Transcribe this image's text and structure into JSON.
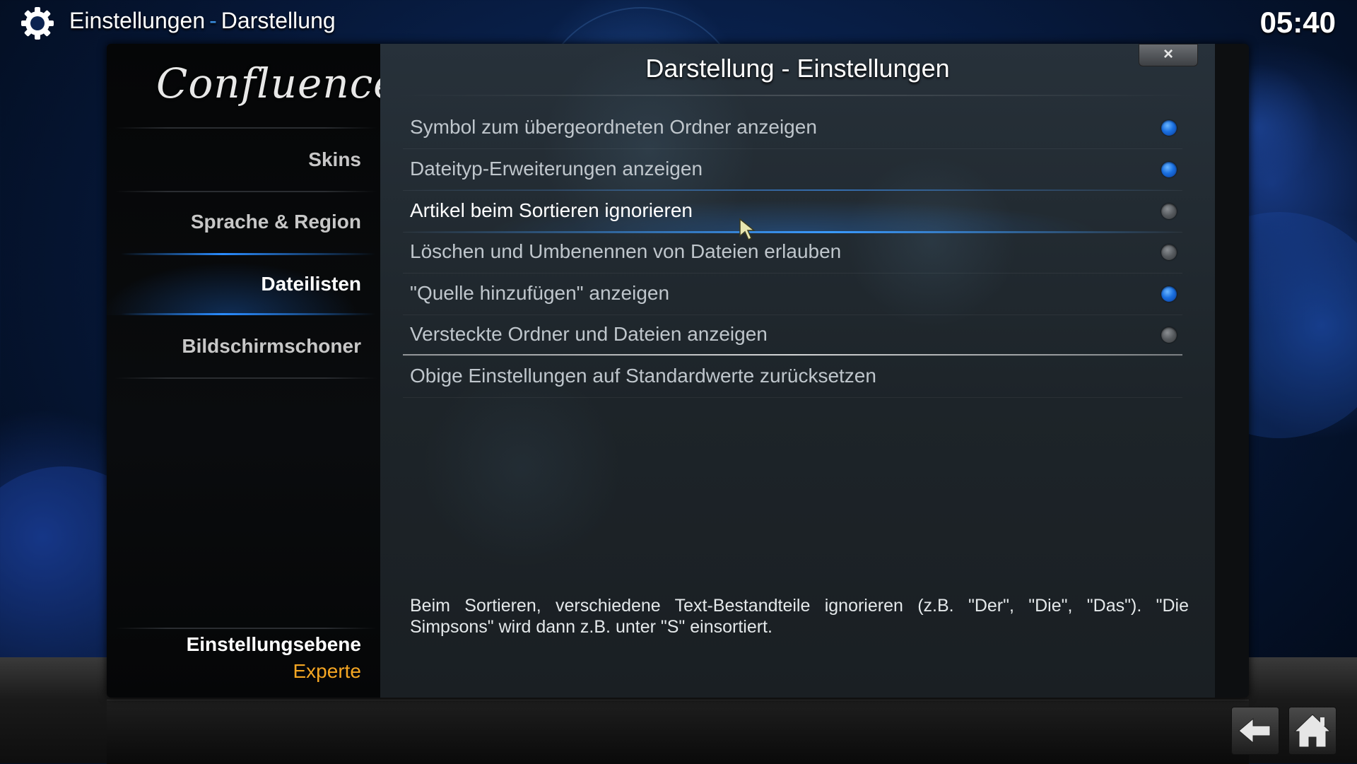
{
  "header": {
    "section": "Einstellungen",
    "separator": "-",
    "page": "Darstellung",
    "clock": "05:40"
  },
  "sidebar": {
    "logo": "Confluence",
    "items": [
      {
        "label": "Skins",
        "active": false
      },
      {
        "label": "Sprache & Region",
        "active": false
      },
      {
        "label": "Dateilisten",
        "active": true
      },
      {
        "label": "Bildschirmschoner",
        "active": false
      }
    ],
    "settings_level_label": "Einstellungsebene",
    "settings_level_value": "Experte"
  },
  "dialog": {
    "title": "Darstellung - Einstellungen",
    "close_icon": "×",
    "settings": [
      {
        "label": "Symbol zum übergeordneten Ordner anzeigen",
        "enabled": true
      },
      {
        "label": "Dateityp-Erweiterungen anzeigen",
        "enabled": true
      },
      {
        "label": "Artikel beim Sortieren ignorieren",
        "enabled": false,
        "focused": true
      },
      {
        "label": "Löschen und Umbenennen von Dateien erlauben",
        "enabled": false
      },
      {
        "label": "\"Quelle hinzufügen\" anzeigen",
        "enabled": true
      },
      {
        "label": "Versteckte Ordner und Dateien anzeigen",
        "enabled": false
      }
    ],
    "reset_label": "Obige Einstellungen auf Standardwerte zurücksetzen",
    "description": "Beim Sortieren, verschiedene Text-Bestandteile ignorieren (z.B. \"Der\", \"Die\", \"Das\").  \"Die Simpsons\" wird dann z.B. unter \"S\" einsortiert."
  },
  "footer": {
    "back_icon": "back-arrow-icon",
    "home_icon": "home-icon"
  },
  "colors": {
    "accent_blue": "#2a8cff",
    "level_orange": "#f5a623",
    "radio_on": "#1a6fe0",
    "radio_off": "#55595d"
  }
}
